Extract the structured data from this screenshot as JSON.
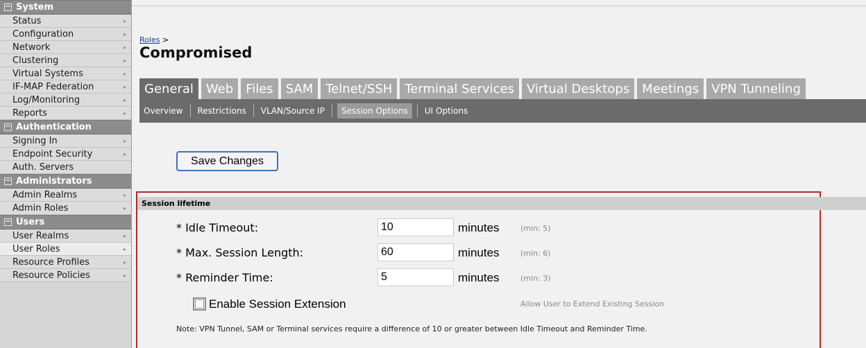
{
  "sidebar": {
    "sections": [
      {
        "title": "System",
        "items": [
          "Status",
          "Configuration",
          "Network",
          "Clustering",
          "Virtual Systems",
          "IF-MAP Federation",
          "Log/Monitoring",
          "Reports"
        ]
      },
      {
        "title": "Authentication",
        "items": [
          "Signing In",
          "Endpoint Security",
          "Auth. Servers"
        ]
      },
      {
        "title": "Administrators",
        "items": [
          "Admin Realms",
          "Admin Roles"
        ]
      },
      {
        "title": "Users",
        "items": [
          "User Realms",
          "User Roles",
          "Resource Profiles",
          "Resource Policies"
        ]
      }
    ],
    "collapse_glyph": "−",
    "arrow_glyph": "▸"
  },
  "breadcrumb": {
    "link": "Roles",
    "separator": ">"
  },
  "page_title": "Compromised",
  "tabs": [
    "General",
    "Web",
    "Files",
    "SAM",
    "Telnet/SSH",
    "Terminal Services",
    "Virtual Desktops",
    "Meetings",
    "VPN Tunneling"
  ],
  "active_tab": "General",
  "subtabs": [
    "Overview",
    "Restrictions",
    "VLAN/Source IP",
    "Session Options",
    "UI Options"
  ],
  "active_subtab": "Session Options",
  "save_label": "Save Changes",
  "session": {
    "header": "Session lifetime",
    "fields": [
      {
        "label": "* Idle Timeout:",
        "value": "10",
        "unit": "minutes",
        "hint": "(min: 5)"
      },
      {
        "label": "* Max. Session Length:",
        "value": "60",
        "unit": "minutes",
        "hint": "(min: 6)"
      },
      {
        "label": "* Reminder Time:",
        "value": "5",
        "unit": "minutes",
        "hint": "(min: 3)"
      }
    ],
    "extension_label": "Enable Session Extension",
    "extension_hint": "Allow User to Extend Existing Session",
    "note": "Note: VPN Tunnel, SAM or Terminal services require a difference of 10 or greater between Idle Timeout and Reminder Time."
  },
  "colors": {
    "accent_border": "#b82525",
    "button_border": "#3c6fbe",
    "tab_active": "#6b6b6b",
    "tab_inactive": "#a9a9a9"
  }
}
